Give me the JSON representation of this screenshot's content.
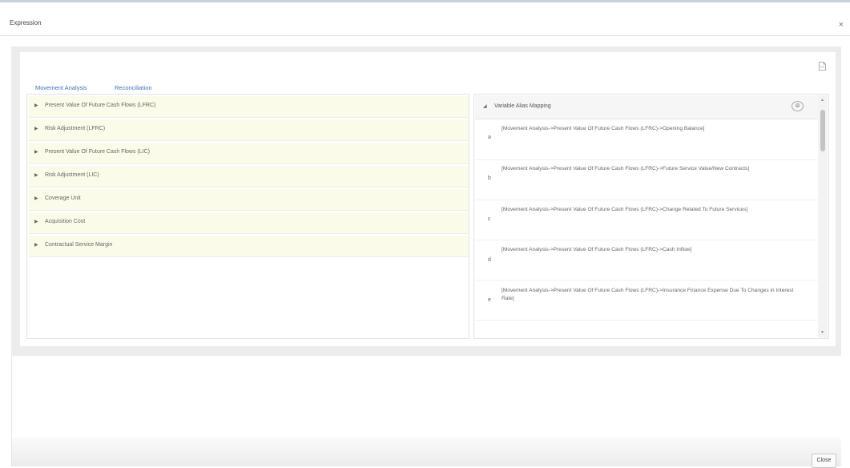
{
  "dialog": {
    "title": "Expression",
    "close_icon": "×"
  },
  "tabs": [
    {
      "label": "Movement Analysis",
      "active": true
    },
    {
      "label": "Reconciliation",
      "active": false
    }
  ],
  "tree": {
    "items": [
      {
        "label": "Present Value Of Future Cash Flows (LFRC)"
      },
      {
        "label": "Risk Adjustment (LFRC)"
      },
      {
        "label": "Present Value Of Future Cash Flows (LIC)"
      },
      {
        "label": "Risk Adjustment (LIC)"
      },
      {
        "label": "Coverage Unit"
      },
      {
        "label": "Acquisition Cost"
      },
      {
        "label": "Contractual Service Margin"
      }
    ]
  },
  "variable_alias": {
    "title": "Variable Alias Mapping",
    "rows": [
      {
        "letter": "a",
        "text": "[Movement Analysis->Present Value Of Future Cash Flows (LFRC)->Opening Balance]"
      },
      {
        "letter": "b",
        "text": "[Movement Analysis->Present Value Of Future Cash Flows (LFRC)->Future Service Value/New Contracts]"
      },
      {
        "letter": "c",
        "text": "[Movement Analysis->Present Value Of Future Cash Flows (LFRC)->Change Related To Future Services]"
      },
      {
        "letter": "d",
        "text": "[Movement Analysis->Present Value Of Future Cash Flows (LFRC)->Cash Inflow]"
      },
      {
        "letter": "e",
        "text": "[Movement Analysis->Present Value Of Future Cash Flows (LFRC)->Insurance Finance Expense Due To Changes in Interest Rate]"
      }
    ]
  },
  "footer": {
    "close_label": "Close"
  },
  "colors": {
    "accent": "#3a73b8",
    "tree_row_bg": "#fbfbe9"
  }
}
